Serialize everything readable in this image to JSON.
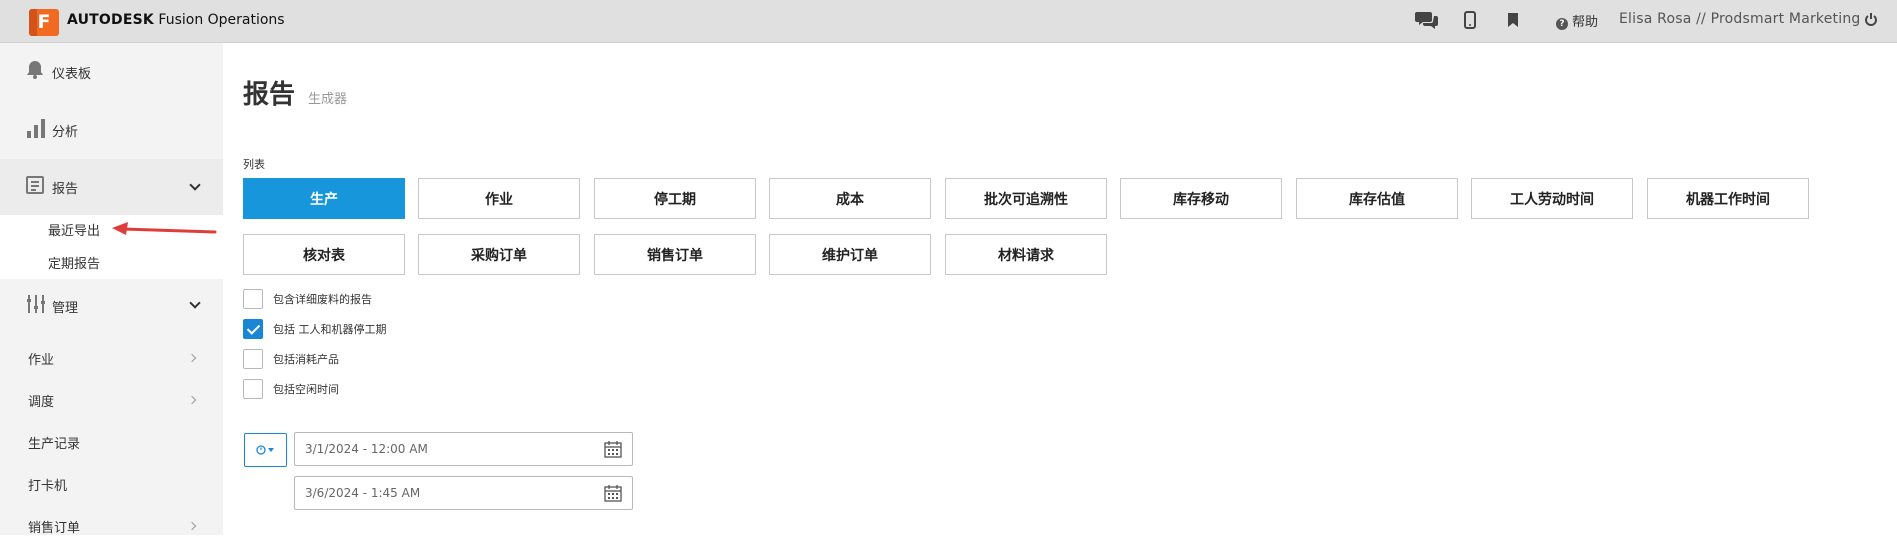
{
  "app": {
    "logo_letter": "F",
    "brand_bold": "AUTODESK",
    "brand_rest": " Fusion Operations",
    "help_label": "帮助",
    "user_label": "Elisa Rosa // Prodsmart Marketing"
  },
  "icons": {
    "chat": "chat-icon",
    "mobile": "mobile-icon",
    "bookmark": "bookmark-icon",
    "help": "help-icon",
    "logout": "logout-icon"
  },
  "sidebar": {
    "dashboard": "仪表板",
    "analysis": "分析",
    "reports": "报告",
    "reports_sub": [
      "最近导出",
      "定期报告"
    ],
    "management": "管理",
    "plain_items": [
      "作业",
      "调度",
      "生产记录",
      "打卡机",
      "销售订单"
    ]
  },
  "main": {
    "title": "报告",
    "subtitle": "生成器",
    "list_label": "列表",
    "report_types_row1": [
      "生产",
      "作业",
      "停工期",
      "成本",
      "批次可追溯性",
      "库存移动",
      "库存估值",
      "工人劳动时间",
      "机器工作时间"
    ],
    "report_types_row2": [
      "核对表",
      "采购订单",
      "销售订单",
      "维护订单",
      "材料请求"
    ],
    "active_type": "生产",
    "options": [
      {
        "label": "包含详细废料的报告",
        "checked": false
      },
      {
        "label": "包括 工人和机器停工期",
        "checked": true
      },
      {
        "label": "包括消耗产品",
        "checked": false
      },
      {
        "label": "包括空闲时间",
        "checked": false
      }
    ],
    "date_from": "3/1/2024 - 12:00 AM",
    "date_to": "3/6/2024 - 1:45 AM"
  },
  "colors": {
    "accent": "#1896dc",
    "brand": "#f26a21",
    "annotation": "#e03c3c"
  }
}
